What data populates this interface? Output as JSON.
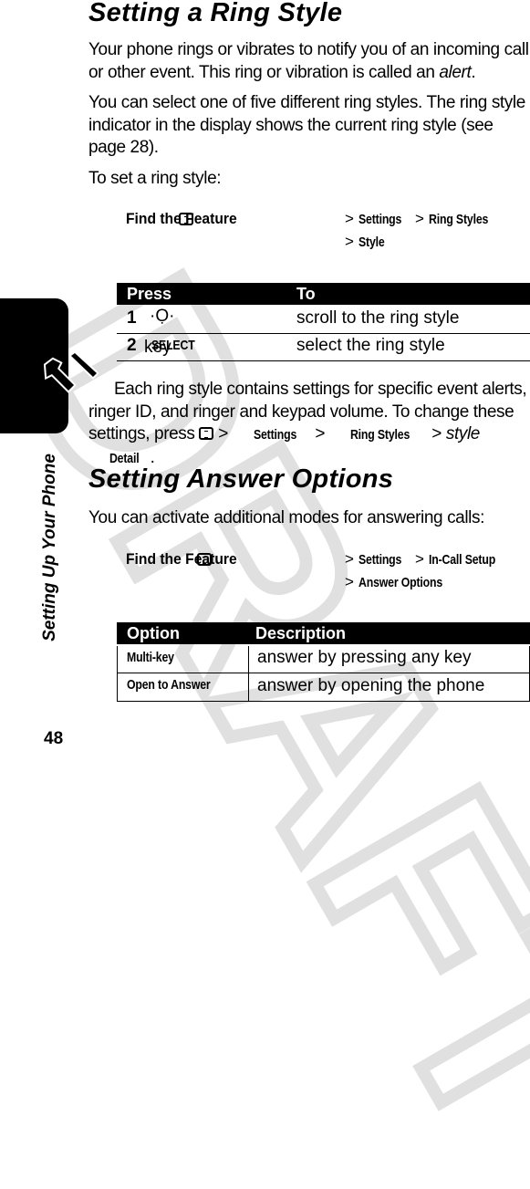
{
  "watermark": "DRAFT",
  "section1": {
    "title": "Setting a Ring Style",
    "para1_a": "Your phone rings or vibrates to notify you of an incoming call or other event. This ring or vibration is called an ",
    "para1_em": "alert",
    "para1_b": ".",
    "para2": "You can select one of five different ring styles. The ring style indicator in the display shows the current ring style (see page 28).",
    "para3": "To set a ring style:",
    "find_feature": {
      "label": "Find the Feature",
      "icon": "menu-key-icon",
      "path_line1": [
        "Settings",
        "Ring Styles"
      ],
      "path_line2": [
        "Style"
      ]
    },
    "table": {
      "headers": [
        "Press",
        "To"
      ],
      "rows": [
        {
          "num": "1",
          "key_icon": "nav-key-icon",
          "key": "",
          "action": "scroll to the ring style"
        },
        {
          "num": "2",
          "key": "SELECT",
          "key_suffix": " key",
          "action": "select the ring style"
        }
      ]
    },
    "para4_a": "Each ring style contains settings for specific event alerts, ringer ID, and ringer and keypad volume. To change these settings, press ",
    "para4_path": [
      "Settings",
      "Ring Styles"
    ],
    "para4_em": "style",
    "para4_end": "Detail",
    "para4_dot": "."
  },
  "section2": {
    "title": "Setting Answer Options",
    "para1": "You can activate additional modes for answering calls:",
    "find_feature": {
      "label": "Find the Feature",
      "icon": "menu-key-icon",
      "path_line1": [
        "Settings",
        "In-Call Setup"
      ],
      "path_line2": [
        "Answer Options"
      ]
    },
    "table": {
      "headers": [
        "Option",
        "Description"
      ],
      "rows": [
        {
          "option": "Multi-key",
          "description": "answer by pressing any key"
        },
        {
          "option": "Open to Answer",
          "description": "answer by opening the phone"
        }
      ]
    }
  },
  "sidebar": {
    "chapter": "Setting Up Your Phone",
    "icon": "wrench-screwdriver-icon"
  },
  "page_number": "48"
}
